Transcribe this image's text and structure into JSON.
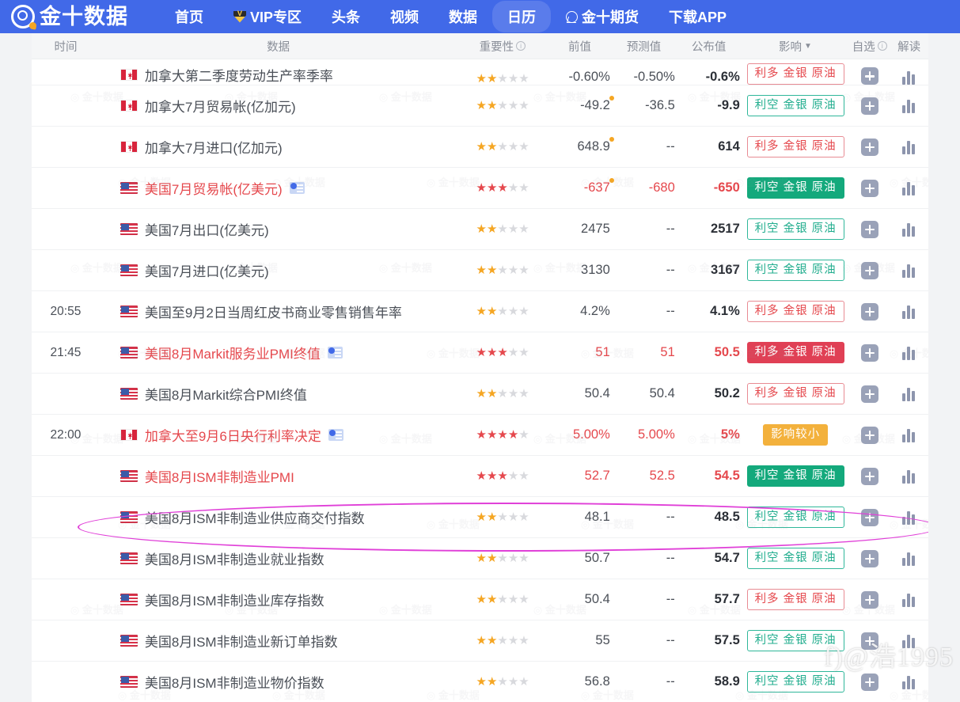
{
  "nav": {
    "logo_text": "金十数据",
    "items": [
      {
        "label": "首页",
        "icon": null,
        "active": false
      },
      {
        "label": "VIP专区",
        "icon": "vip-diamond-icon",
        "active": false
      },
      {
        "label": "头条",
        "icon": null,
        "active": false
      },
      {
        "label": "视频",
        "icon": null,
        "active": false
      },
      {
        "label": "数据",
        "icon": null,
        "active": false
      },
      {
        "label": "日历",
        "icon": null,
        "active": true
      },
      {
        "label": "金十期货",
        "icon": "futures-icon",
        "active": false
      },
      {
        "label": "下载APP",
        "icon": null,
        "active": false
      }
    ],
    "accent_color": "#4169e8"
  },
  "table": {
    "headers": {
      "time": "时间",
      "data": "数据",
      "importance": "重要性",
      "previous": "前值",
      "forecast": "预测值",
      "actual": "公布值",
      "impact": "影响",
      "watchlist": "自选",
      "analysis": "解读"
    },
    "rows": [
      {
        "time": "",
        "flag": "ca",
        "name": "加拿大第二季度劳动生产率季率",
        "stars": 2,
        "star_color": "y",
        "hot": false,
        "video": false,
        "previous": "-0.60%",
        "prev_dot": false,
        "forecast": "-0.50%",
        "actual": "-0.6%",
        "badge": {
          "text": "利多 金银 原油",
          "style": "out-bull"
        },
        "partial": true
      },
      {
        "time": "",
        "flag": "ca",
        "name": "加拿大7月贸易帐(亿加元)",
        "stars": 2,
        "star_color": "y",
        "hot": false,
        "video": false,
        "previous": "-49.2",
        "prev_dot": true,
        "forecast": "-36.5",
        "actual": "-9.9",
        "badge": {
          "text": "利空 金银 原油",
          "style": "out-bear"
        }
      },
      {
        "time": "",
        "flag": "ca",
        "name": "加拿大7月进口(亿加元)",
        "stars": 2,
        "star_color": "y",
        "hot": false,
        "video": false,
        "previous": "648.9",
        "prev_dot": true,
        "forecast": "--",
        "actual": "614",
        "badge": {
          "text": "利多 金银 原油",
          "style": "out-bull"
        }
      },
      {
        "time": "",
        "flag": "us",
        "name": "美国7月贸易帐(亿美元)",
        "stars": 3,
        "star_color": "r",
        "hot": true,
        "video": true,
        "previous": "-637",
        "prev_dot": true,
        "forecast": "-680",
        "actual": "-650",
        "badge": {
          "text": "利空 金银 原油",
          "style": "fill-bear"
        }
      },
      {
        "time": "",
        "flag": "us",
        "name": "美国7月出口(亿美元)",
        "stars": 2,
        "star_color": "y",
        "hot": false,
        "video": false,
        "previous": "2475",
        "prev_dot": false,
        "forecast": "--",
        "actual": "2517",
        "badge": {
          "text": "利空 金银 原油",
          "style": "out-bear"
        }
      },
      {
        "time": "",
        "flag": "us",
        "name": "美国7月进口(亿美元)",
        "stars": 2,
        "star_color": "y",
        "hot": false,
        "video": false,
        "previous": "3130",
        "prev_dot": false,
        "forecast": "--",
        "actual": "3167",
        "badge": {
          "text": "利空 金银 原油",
          "style": "out-bear"
        }
      },
      {
        "time": "20:55",
        "flag": "us",
        "name": "美国至9月2日当周红皮书商业零售销售年率",
        "stars": 2,
        "star_color": "y",
        "hot": false,
        "video": false,
        "previous": "4.2%",
        "prev_dot": false,
        "forecast": "--",
        "actual": "4.1%",
        "badge": {
          "text": "利多 金银 原油",
          "style": "out-bull"
        }
      },
      {
        "time": "21:45",
        "flag": "us",
        "name": "美国8月Markit服务业PMI终值",
        "stars": 3,
        "star_color": "r",
        "hot": true,
        "video": true,
        "previous": "51",
        "prev_dot": false,
        "forecast": "51",
        "actual": "50.5",
        "badge": {
          "text": "利多 金银 原油",
          "style": "fill-bull"
        }
      },
      {
        "time": "",
        "flag": "us",
        "name": "美国8月Markit综合PMI终值",
        "stars": 2,
        "star_color": "y",
        "hot": false,
        "video": false,
        "previous": "50.4",
        "prev_dot": false,
        "forecast": "50.4",
        "actual": "50.2",
        "badge": {
          "text": "利多 金银 原油",
          "style": "out-bull"
        }
      },
      {
        "time": "22:00",
        "flag": "ca",
        "name": "加拿大至9月6日央行利率决定",
        "stars": 4,
        "star_color": "r",
        "hot": true,
        "video": true,
        "previous": "5.00%",
        "prev_dot": false,
        "forecast": "5.00%",
        "actual": "5%",
        "badge": {
          "text": "影响较小",
          "style": "fill-warn"
        }
      },
      {
        "time": "",
        "flag": "us",
        "name": "美国8月ISM非制造业PMI",
        "stars": 3,
        "star_color": "r",
        "hot": true,
        "video": false,
        "previous": "52.7",
        "prev_dot": false,
        "forecast": "52.5",
        "actual": "54.5",
        "badge": {
          "text": "利空 金银 原油",
          "style": "fill-bear"
        },
        "circled": true
      },
      {
        "time": "",
        "flag": "us",
        "name": "美国8月ISM非制造业供应商交付指数",
        "stars": 2,
        "star_color": "y",
        "hot": false,
        "video": false,
        "previous": "48.1",
        "prev_dot": false,
        "forecast": "--",
        "actual": "48.5",
        "badge": {
          "text": "利空 金银 原油",
          "style": "out-bear"
        }
      },
      {
        "time": "",
        "flag": "us",
        "name": "美国8月ISM非制造业就业指数",
        "stars": 2,
        "star_color": "y",
        "hot": false,
        "video": false,
        "previous": "50.7",
        "prev_dot": false,
        "forecast": "--",
        "actual": "54.7",
        "badge": {
          "text": "利空 金银 原油",
          "style": "out-bear"
        }
      },
      {
        "time": "",
        "flag": "us",
        "name": "美国8月ISM非制造业库存指数",
        "stars": 2,
        "star_color": "y",
        "hot": false,
        "video": false,
        "previous": "50.4",
        "prev_dot": false,
        "forecast": "--",
        "actual": "57.7",
        "badge": {
          "text": "利多 金银 原油",
          "style": "out-bull"
        }
      },
      {
        "time": "",
        "flag": "us",
        "name": "美国8月ISM非制造业新订单指数",
        "stars": 2,
        "star_color": "y",
        "hot": false,
        "video": false,
        "previous": "55",
        "prev_dot": false,
        "forecast": "--",
        "actual": "57.5",
        "badge": {
          "text": "利空 金银 原油",
          "style": "out-bear"
        }
      },
      {
        "time": "",
        "flag": "us",
        "name": "美国8月ISM非制造业物价指数",
        "stars": 2,
        "star_color": "y",
        "hot": false,
        "video": false,
        "previous": "56.8",
        "prev_dot": false,
        "forecast": "--",
        "actual": "58.9",
        "badge": {
          "text": "利空 金银 原油",
          "style": "out-bear"
        }
      }
    ]
  },
  "annotation": {
    "ellipse_color": "#e040d8",
    "ellipse_target": "美国8月ISM非制造业PMI"
  },
  "watermarks": {
    "tile_text": "金十数据",
    "user_text": "f)@浩1995"
  }
}
